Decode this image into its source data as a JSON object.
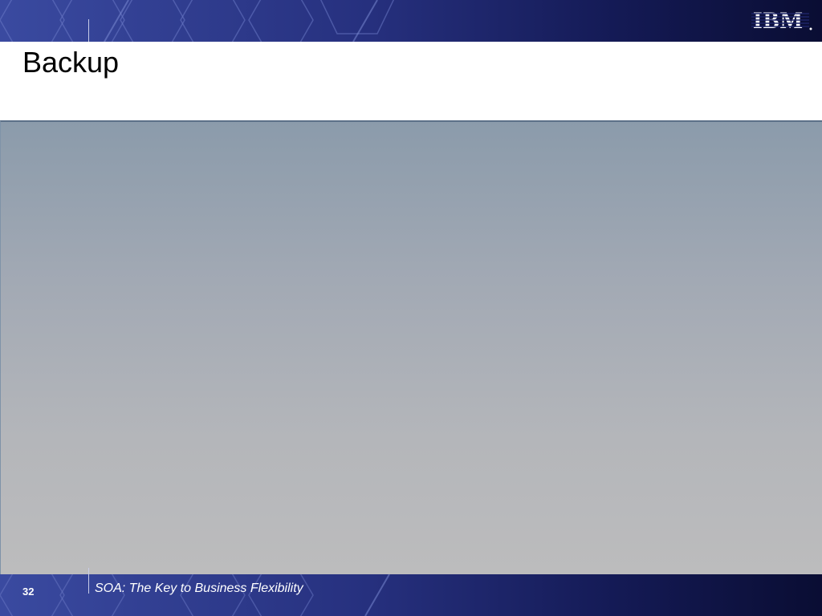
{
  "slide": {
    "title": "Backup",
    "logo_text": "IBM",
    "page_number": "32",
    "footer_text": "SOA: The Key to Business Flexibility"
  },
  "colors": {
    "banner_dark": "#0a0d33",
    "banner_light": "#3a4aa0",
    "panel_top": "#8b9bab",
    "panel_bottom": "#bcbcbd"
  }
}
